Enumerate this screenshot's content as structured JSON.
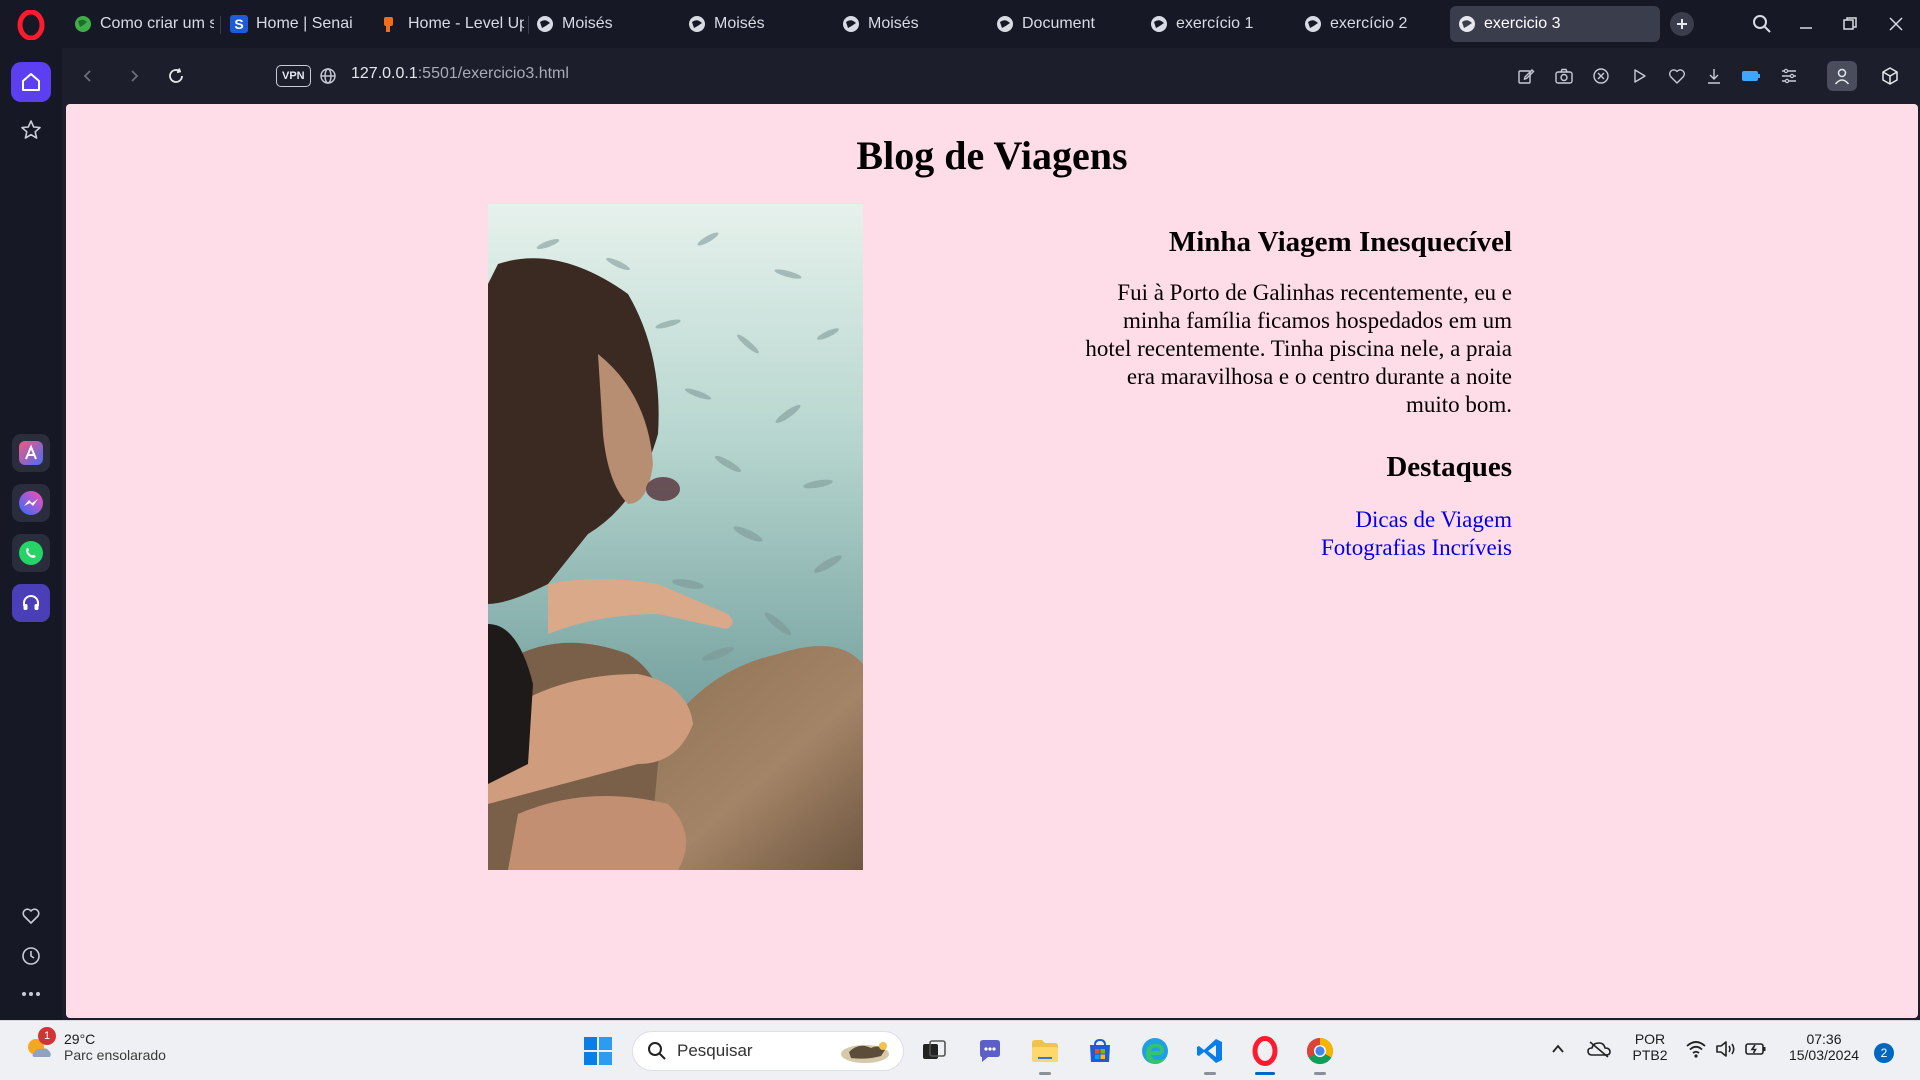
{
  "browser": {
    "tabs": [
      {
        "title": "Como criar um sli",
        "favicon": "green-globe-icon"
      },
      {
        "title": "Home | Senai",
        "favicon": "senai-s-icon"
      },
      {
        "title": "Home - Level Up!",
        "favicon": "levelup-icon"
      },
      {
        "title": "Moisés",
        "favicon": "globe-icon"
      },
      {
        "title": "Moisés",
        "favicon": "globe-icon"
      },
      {
        "title": "Moisés",
        "favicon": "globe-icon"
      },
      {
        "title": "Document",
        "favicon": "globe-icon"
      },
      {
        "title": "exercício 1",
        "favicon": "globe-icon"
      },
      {
        "title": "exercício 2",
        "favicon": "globe-icon"
      },
      {
        "title": "exercicio 3",
        "favicon": "globe-icon",
        "active": true
      }
    ],
    "vpn_label": "VPN",
    "url_host": "127.0.0.1",
    "url_path": ":5501/exercicio3.html",
    "accent_color": "#5b3ff0"
  },
  "page": {
    "background": "#ffdde8",
    "title": "Blog de Viagens",
    "article_title": "Minha Viagem Inesquecível",
    "article_body": "Fui à Porto de Galinhas recentemente, eu e minha família ficamos hospedados em um hotel recentemente. Tinha piscina nele, a praia era maravilhosa e o centro durante a noite muito bom.",
    "highlights_title": "Destaques",
    "links": [
      "Dicas de Viagem",
      "Fotografias Incríveis"
    ],
    "link_color": "#0000ee"
  },
  "taskbar": {
    "weather_temp": "29°C",
    "weather_condition": "Parc ensolarado",
    "weather_badge": "1",
    "search_placeholder": "Pesquisar",
    "lang_top": "POR",
    "lang_bottom": "PTB2",
    "time": "07:36",
    "date": "15/03/2024",
    "notification_count": "2"
  }
}
